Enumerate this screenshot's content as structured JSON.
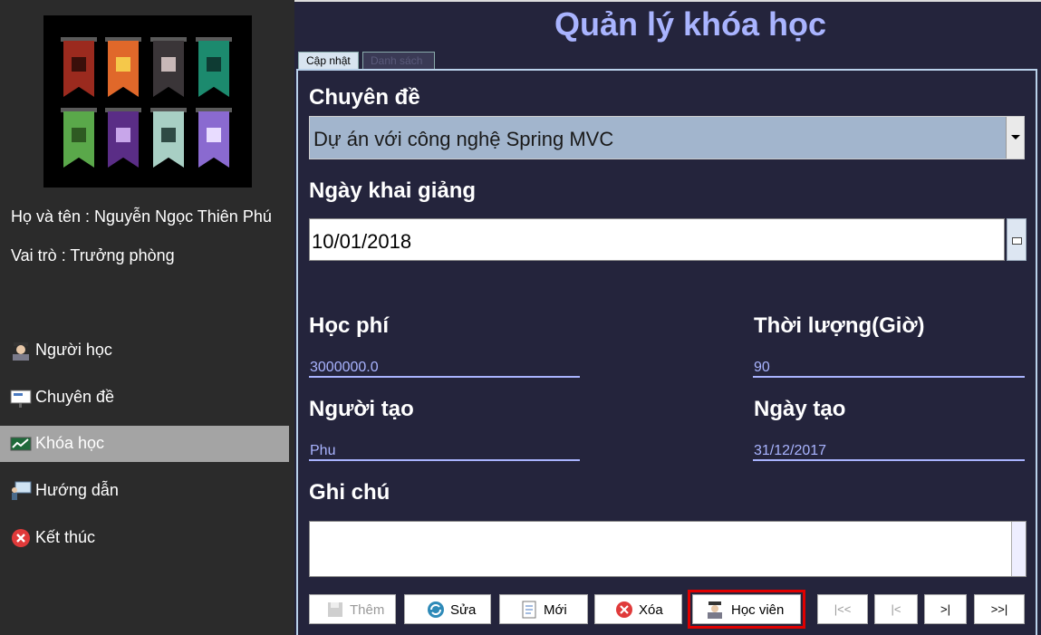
{
  "sidebar": {
    "user_name_line": "Họ và tên : Nguyễn Ngọc Thiên Phú",
    "role_line": "Vai trò : Trưởng phòng",
    "items": [
      {
        "label": "Người học",
        "icon": "student-icon"
      },
      {
        "label": "Chuyên đề",
        "icon": "board-icon"
      },
      {
        "label": "Khóa học",
        "icon": "chart-icon",
        "active": true
      },
      {
        "label": "Hướng dẫn",
        "icon": "presentation-icon"
      },
      {
        "label": "Kết thúc",
        "icon": "close-circle-icon"
      }
    ]
  },
  "header": {
    "title": "Quản lý khóa học"
  },
  "tabs": [
    {
      "label": "Cập nhật",
      "active": true
    },
    {
      "label": "Danh sách",
      "active": false
    }
  ],
  "form": {
    "topic_label": "Chuyên đề",
    "topic_value": "Dự án với công nghệ Spring MVC",
    "start_date_label": "Ngày khai giảng",
    "start_date_value": "10/01/2018",
    "fee_label": "Học phí",
    "fee_value": "3000000.0",
    "duration_label": "Thời lượng(Giờ)",
    "duration_value": "90",
    "creator_label": "Người tạo",
    "creator_value": "Phu",
    "created_date_label": "Ngày tạo",
    "created_date_value": "31/12/2017",
    "notes_label": "Ghi chú",
    "notes_value": ""
  },
  "buttons": {
    "add": "Thêm",
    "edit": "Sửa",
    "new": "Mới",
    "delete": "Xóa",
    "students": "Học viên",
    "first": "|<<",
    "prev": "|<",
    "next": ">|",
    "last": ">>|"
  },
  "colors": {
    "accent": "#a9b4ff",
    "background": "#24243c",
    "sidebar": "#2b2b2b",
    "highlight": "#e00000"
  }
}
